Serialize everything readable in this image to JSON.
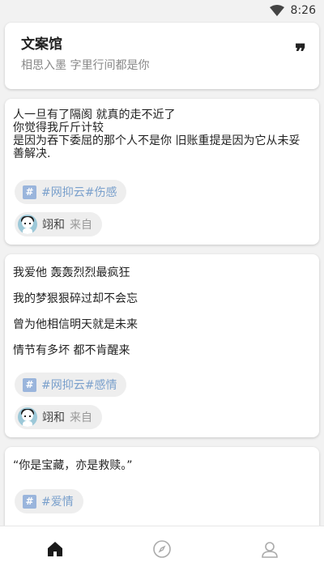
{
  "status_bar": {
    "time": "8:26"
  },
  "header": {
    "title": "文案馆",
    "subtitle": "相思入墨 字里行间都是你",
    "quote_icon": "❞"
  },
  "posts": [
    {
      "text": "人一旦有了隔阂 就真的走不近了\n你觉得我斤斤计较\n是因为吞下委屈的那个人不是你 旧账重提是因为它从未妥善解决.",
      "tag": "#网抑云#伤感",
      "author": "翊和",
      "from": "来自"
    },
    {
      "lines": [
        "我爱他 轰轰烈烈最疯狂",
        "我的梦狠狠碎过却不会忘",
        "曾为他相信明天就是未来",
        "情节有多坏 都不肯醒来"
      ],
      "tag": "#网抑云#感情",
      "author": "翊和",
      "from": "来自"
    },
    {
      "text": "“你是宝藏，亦是救赎。”",
      "tag": "#爱情"
    }
  ],
  "tag_hash": "#",
  "nav": [
    "home-icon",
    "compass-icon",
    "profile-icon"
  ],
  "colors": {
    "tag_text": "#7aa0cc",
    "tag_icon_bg": "#9ab5dc",
    "background": "#f2f2f2"
  }
}
